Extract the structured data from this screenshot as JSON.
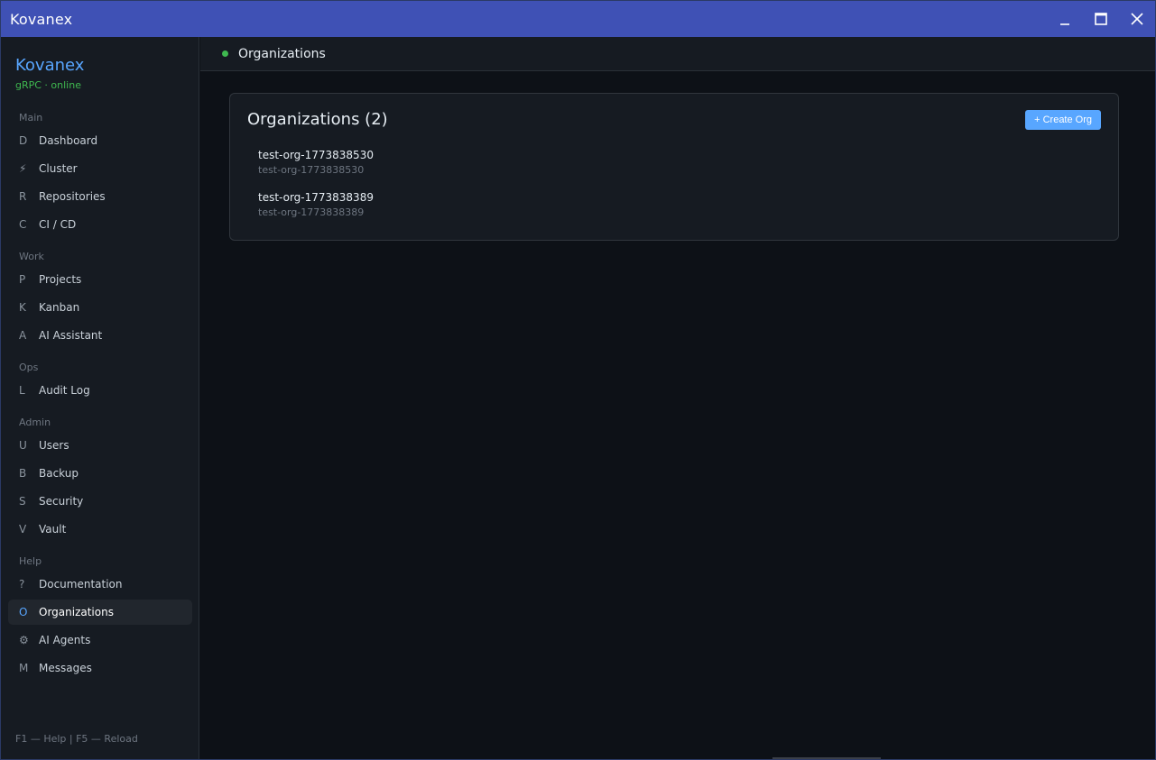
{
  "window": {
    "title": "Kovanex"
  },
  "sidebar": {
    "brand": "Kovanex",
    "status": "gRPC · online",
    "sections": [
      {
        "label": "Main",
        "items": [
          {
            "key": "D",
            "label": "Dashboard"
          },
          {
            "key": "⚡",
            "label": "Cluster"
          },
          {
            "key": "R",
            "label": "Repositories"
          },
          {
            "key": "C",
            "label": "CI / CD"
          }
        ]
      },
      {
        "label": "Work",
        "items": [
          {
            "key": "P",
            "label": "Projects"
          },
          {
            "key": "K",
            "label": "Kanban"
          },
          {
            "key": "A",
            "label": "AI Assistant"
          }
        ]
      },
      {
        "label": "Ops",
        "items": [
          {
            "key": "L",
            "label": "Audit Log"
          }
        ]
      },
      {
        "label": "Admin",
        "items": [
          {
            "key": "U",
            "label": "Users"
          },
          {
            "key": "B",
            "label": "Backup"
          },
          {
            "key": "S",
            "label": "Security"
          },
          {
            "key": "V",
            "label": "Vault"
          }
        ]
      },
      {
        "label": "Help",
        "items": [
          {
            "key": "?",
            "label": "Documentation"
          },
          {
            "key": "O",
            "label": "Organizations",
            "active": true
          },
          {
            "key": "⚙",
            "label": "AI Agents"
          },
          {
            "key": "M",
            "label": "Messages"
          }
        ]
      }
    ],
    "footer": "F1 — Help  |  F5 — Reload"
  },
  "topbar": {
    "title": "Organizations"
  },
  "card": {
    "title": "Organizations (2)",
    "create_button": "+ Create Org",
    "orgs": [
      {
        "name": "test-org-1773838530",
        "slug": "test-org-1773838530"
      },
      {
        "name": "test-org-1773838389",
        "slug": "test-org-1773838389"
      }
    ]
  },
  "colors": {
    "titlebar": "#3f51b5",
    "accent": "#58a6ff",
    "online": "#3fb950",
    "background": "#0d1117",
    "panel": "#161b22"
  }
}
